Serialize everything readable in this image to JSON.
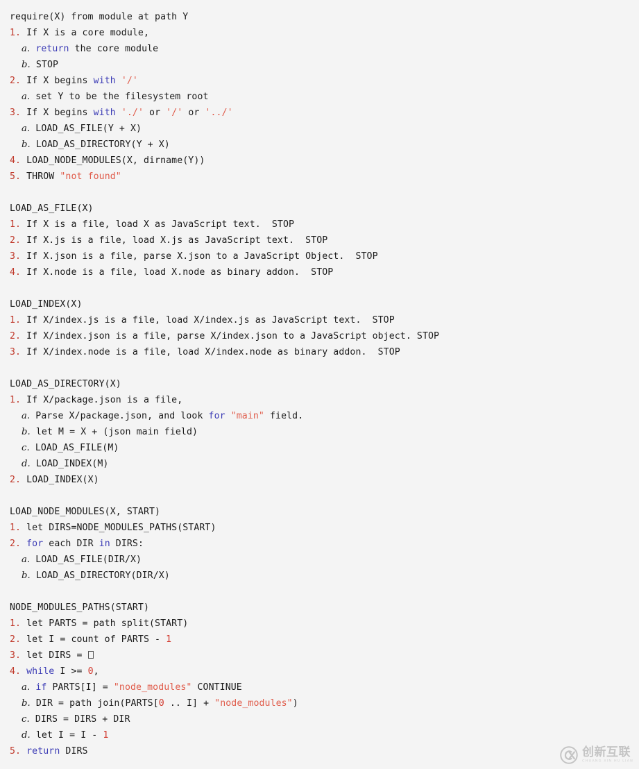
{
  "page": {
    "background_color": "#f4f4f4",
    "text_color": "#1a1a1a",
    "accent_marker_color": "#c0392b",
    "keyword_color": "#3b3bb5",
    "string_color": "#e05c4b",
    "literal_color": "#d1372c"
  },
  "code": {
    "language": "pseudocode",
    "lines": [
      {
        "indent": 0,
        "tokens": [
          {
            "t": "plain",
            "v": "require(X) from module at path Y"
          }
        ]
      },
      {
        "indent": 0,
        "tokens": [
          {
            "t": "num",
            "v": "1."
          },
          {
            "t": "plain",
            "v": " If X is a core module,"
          }
        ]
      },
      {
        "indent": 2,
        "tokens": [
          {
            "t": "alpha",
            "v": "a."
          },
          {
            "t": "plain",
            "v": " "
          },
          {
            "t": "kw",
            "v": "return"
          },
          {
            "t": "plain",
            "v": " the core module"
          }
        ]
      },
      {
        "indent": 2,
        "tokens": [
          {
            "t": "alpha",
            "v": "b."
          },
          {
            "t": "plain",
            "v": " STOP"
          }
        ]
      },
      {
        "indent": 0,
        "tokens": [
          {
            "t": "num",
            "v": "2."
          },
          {
            "t": "plain",
            "v": " If X begins "
          },
          {
            "t": "kw",
            "v": "with"
          },
          {
            "t": "plain",
            "v": " "
          },
          {
            "t": "str",
            "v": "'/'"
          }
        ]
      },
      {
        "indent": 2,
        "tokens": [
          {
            "t": "alpha",
            "v": "a."
          },
          {
            "t": "plain",
            "v": " set Y to be the filesystem root"
          }
        ]
      },
      {
        "indent": 0,
        "tokens": [
          {
            "t": "num",
            "v": "3."
          },
          {
            "t": "plain",
            "v": " If X begins "
          },
          {
            "t": "kw",
            "v": "with"
          },
          {
            "t": "plain",
            "v": " "
          },
          {
            "t": "str",
            "v": "'./'"
          },
          {
            "t": "plain",
            "v": " or "
          },
          {
            "t": "str",
            "v": "'/'"
          },
          {
            "t": "plain",
            "v": " or "
          },
          {
            "t": "str",
            "v": "'../'"
          }
        ]
      },
      {
        "indent": 2,
        "tokens": [
          {
            "t": "alpha",
            "v": "a."
          },
          {
            "t": "plain",
            "v": " LOAD_AS_FILE(Y + X)"
          }
        ]
      },
      {
        "indent": 2,
        "tokens": [
          {
            "t": "alpha",
            "v": "b."
          },
          {
            "t": "plain",
            "v": " LOAD_AS_DIRECTORY(Y + X)"
          }
        ]
      },
      {
        "indent": 0,
        "tokens": [
          {
            "t": "num",
            "v": "4."
          },
          {
            "t": "plain",
            "v": " LOAD_NODE_MODULES(X, dirname(Y))"
          }
        ]
      },
      {
        "indent": 0,
        "tokens": [
          {
            "t": "num",
            "v": "5."
          },
          {
            "t": "plain",
            "v": " THROW "
          },
          {
            "t": "str",
            "v": "\"not found\""
          }
        ]
      },
      {
        "indent": 0,
        "tokens": []
      },
      {
        "indent": 0,
        "tokens": [
          {
            "t": "head",
            "v": "LOAD_AS_FILE(X)"
          }
        ]
      },
      {
        "indent": 0,
        "tokens": [
          {
            "t": "num",
            "v": "1."
          },
          {
            "t": "plain",
            "v": " If X is a file, load X as JavaScript text.  STOP"
          }
        ]
      },
      {
        "indent": 0,
        "tokens": [
          {
            "t": "num",
            "v": "2."
          },
          {
            "t": "plain",
            "v": " If X.js is a file, load X.js as JavaScript text.  STOP"
          }
        ]
      },
      {
        "indent": 0,
        "tokens": [
          {
            "t": "num",
            "v": "3."
          },
          {
            "t": "plain",
            "v": " If X.json is a file, parse X.json to a JavaScript Object.  STOP"
          }
        ]
      },
      {
        "indent": 0,
        "tokens": [
          {
            "t": "num",
            "v": "4."
          },
          {
            "t": "plain",
            "v": " If X.node is a file, load X.node as binary addon.  STOP"
          }
        ]
      },
      {
        "indent": 0,
        "tokens": []
      },
      {
        "indent": 0,
        "tokens": [
          {
            "t": "head",
            "v": "LOAD_INDEX(X)"
          }
        ]
      },
      {
        "indent": 0,
        "tokens": [
          {
            "t": "num",
            "v": "1."
          },
          {
            "t": "plain",
            "v": " If X/index.js is a file, load X/index.js as JavaScript text.  STOP"
          }
        ]
      },
      {
        "indent": 0,
        "tokens": [
          {
            "t": "num",
            "v": "2."
          },
          {
            "t": "plain",
            "v": " If X/index.json is a file, parse X/index.json to a JavaScript object. STOP"
          }
        ]
      },
      {
        "indent": 0,
        "tokens": [
          {
            "t": "num",
            "v": "3."
          },
          {
            "t": "plain",
            "v": " If X/index.node is a file, load X/index.node as binary addon.  STOP"
          }
        ]
      },
      {
        "indent": 0,
        "tokens": []
      },
      {
        "indent": 0,
        "tokens": [
          {
            "t": "head",
            "v": "LOAD_AS_DIRECTORY(X)"
          }
        ]
      },
      {
        "indent": 0,
        "tokens": [
          {
            "t": "num",
            "v": "1."
          },
          {
            "t": "plain",
            "v": " If X/package.json is a file,"
          }
        ]
      },
      {
        "indent": 2,
        "tokens": [
          {
            "t": "alpha",
            "v": "a."
          },
          {
            "t": "plain",
            "v": " Parse X/package.json, and look "
          },
          {
            "t": "kw",
            "v": "for"
          },
          {
            "t": "plain",
            "v": " "
          },
          {
            "t": "str",
            "v": "\"main\""
          },
          {
            "t": "plain",
            "v": " field."
          }
        ]
      },
      {
        "indent": 2,
        "tokens": [
          {
            "t": "alpha",
            "v": "b."
          },
          {
            "t": "plain",
            "v": " let M = X + (json main field)"
          }
        ]
      },
      {
        "indent": 2,
        "tokens": [
          {
            "t": "alpha",
            "v": "c."
          },
          {
            "t": "plain",
            "v": " LOAD_AS_FILE(M)"
          }
        ]
      },
      {
        "indent": 2,
        "tokens": [
          {
            "t": "alpha",
            "v": "d."
          },
          {
            "t": "plain",
            "v": " LOAD_INDEX(M)"
          }
        ]
      },
      {
        "indent": 0,
        "tokens": [
          {
            "t": "num",
            "v": "2."
          },
          {
            "t": "plain",
            "v": " LOAD_INDEX(X)"
          }
        ]
      },
      {
        "indent": 0,
        "tokens": []
      },
      {
        "indent": 0,
        "tokens": [
          {
            "t": "head",
            "v": "LOAD_NODE_MODULES(X, START)"
          }
        ]
      },
      {
        "indent": 0,
        "tokens": [
          {
            "t": "num",
            "v": "1."
          },
          {
            "t": "plain",
            "v": " let DIRS=NODE_MODULES_PATHS(START)"
          }
        ]
      },
      {
        "indent": 0,
        "tokens": [
          {
            "t": "num",
            "v": "2."
          },
          {
            "t": "plain",
            "v": " "
          },
          {
            "t": "kw",
            "v": "for"
          },
          {
            "t": "plain",
            "v": " each DIR "
          },
          {
            "t": "kw",
            "v": "in"
          },
          {
            "t": "plain",
            "v": " DIRS:"
          }
        ]
      },
      {
        "indent": 2,
        "tokens": [
          {
            "t": "alpha",
            "v": "a."
          },
          {
            "t": "plain",
            "v": " LOAD_AS_FILE(DIR/X)"
          }
        ]
      },
      {
        "indent": 2,
        "tokens": [
          {
            "t": "alpha",
            "v": "b."
          },
          {
            "t": "plain",
            "v": " LOAD_AS_DIRECTORY(DIR/X)"
          }
        ]
      },
      {
        "indent": 0,
        "tokens": []
      },
      {
        "indent": 0,
        "tokens": [
          {
            "t": "head",
            "v": "NODE_MODULES_PATHS(START)"
          }
        ]
      },
      {
        "indent": 0,
        "tokens": [
          {
            "t": "num",
            "v": "1."
          },
          {
            "t": "plain",
            "v": " let PARTS = path split(START)"
          }
        ]
      },
      {
        "indent": 0,
        "tokens": [
          {
            "t": "num",
            "v": "2."
          },
          {
            "t": "plain",
            "v": " let I = count of PARTS - "
          },
          {
            "t": "lit",
            "v": "1"
          }
        ]
      },
      {
        "indent": 0,
        "tokens": [
          {
            "t": "num",
            "v": "3."
          },
          {
            "t": "plain",
            "v": " let DIRS = "
          },
          {
            "t": "tofu",
            "v": "[]"
          }
        ]
      },
      {
        "indent": 0,
        "tokens": [
          {
            "t": "num",
            "v": "4."
          },
          {
            "t": "plain",
            "v": " "
          },
          {
            "t": "kw",
            "v": "while"
          },
          {
            "t": "plain",
            "v": " I >= "
          },
          {
            "t": "lit",
            "v": "0"
          },
          {
            "t": "plain",
            "v": ","
          }
        ]
      },
      {
        "indent": 2,
        "tokens": [
          {
            "t": "alpha",
            "v": "a."
          },
          {
            "t": "plain",
            "v": " "
          },
          {
            "t": "kw",
            "v": "if"
          },
          {
            "t": "plain",
            "v": " PARTS[I] = "
          },
          {
            "t": "str",
            "v": "\"node_modules\""
          },
          {
            "t": "plain",
            "v": " CONTINUE"
          }
        ]
      },
      {
        "indent": 2,
        "tokens": [
          {
            "t": "alpha",
            "v": "b."
          },
          {
            "t": "plain",
            "v": " DIR = path join(PARTS["
          },
          {
            "t": "lit",
            "v": "0"
          },
          {
            "t": "plain",
            "v": " .. I] + "
          },
          {
            "t": "str",
            "v": "\"node_modules\""
          },
          {
            "t": "plain",
            "v": ")"
          }
        ]
      },
      {
        "indent": 2,
        "tokens": [
          {
            "t": "alpha",
            "v": "c."
          },
          {
            "t": "plain",
            "v": " DIRS = DIRS + DIR"
          }
        ]
      },
      {
        "indent": 2,
        "tokens": [
          {
            "t": "alpha",
            "v": "d."
          },
          {
            "t": "plain",
            "v": " let I = I - "
          },
          {
            "t": "lit",
            "v": "1"
          }
        ]
      },
      {
        "indent": 0,
        "tokens": [
          {
            "t": "num",
            "v": "5."
          },
          {
            "t": "plain",
            "v": " "
          },
          {
            "t": "kw",
            "v": "return"
          },
          {
            "t": "plain",
            "v": " DIRS"
          }
        ]
      }
    ]
  },
  "watermark": {
    "logo_label": "CX",
    "brand_cn": "创新互联",
    "brand_pinyin": "CHUANG XIN HU LIAN",
    "color": "#9a9a9a"
  }
}
